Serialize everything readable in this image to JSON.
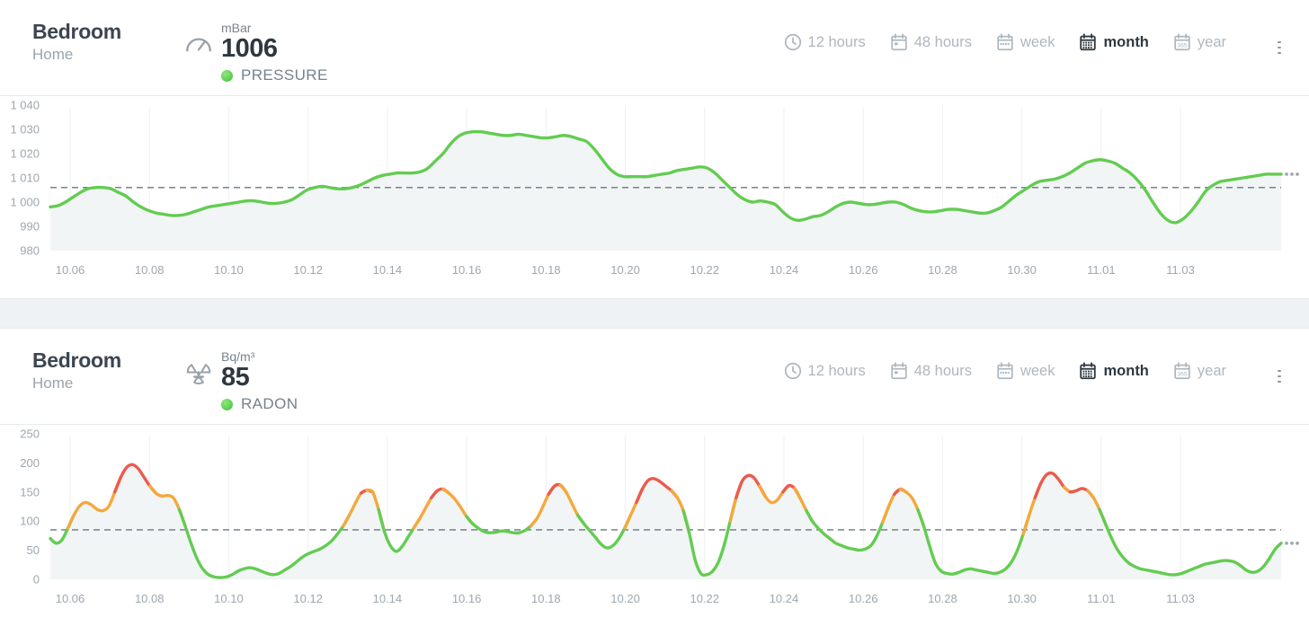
{
  "panels": [
    {
      "device": {
        "name": "Bedroom",
        "location": "Home"
      },
      "metric": {
        "icon": "gauge-icon",
        "unit": "mBar",
        "value": "1006",
        "label": "PRESSURE",
        "status_color": "#5ccd4d"
      },
      "ranges": [
        {
          "key": "12h",
          "label": "12 hours",
          "icon": "clock-icon",
          "active": false
        },
        {
          "key": "48h",
          "label": "48 hours",
          "icon": "calendar-2-icon",
          "active": false
        },
        {
          "key": "week",
          "label": "week",
          "icon": "calendar-7-icon",
          "active": false
        },
        {
          "key": "month",
          "label": "month",
          "icon": "calendar-30-icon",
          "active": true
        },
        {
          "key": "year",
          "label": "year",
          "icon": "calendar-365-icon",
          "active": false
        }
      ],
      "menu": {
        "label": "more-options"
      }
    },
    {
      "device": {
        "name": "Bedroom",
        "location": "Home"
      },
      "metric": {
        "icon": "radiation-icon",
        "unit": "Bq/m³",
        "value": "85",
        "label": "RADON",
        "status_color": "#5ccd4d"
      },
      "ranges": [
        {
          "key": "12h",
          "label": "12 hours",
          "icon": "clock-icon",
          "active": false
        },
        {
          "key": "48h",
          "label": "48 hours",
          "icon": "calendar-2-icon",
          "active": false
        },
        {
          "key": "week",
          "label": "week",
          "icon": "calendar-7-icon",
          "active": false
        },
        {
          "key": "month",
          "label": "month",
          "icon": "calendar-30-icon",
          "active": true
        },
        {
          "key": "year",
          "label": "year",
          "icon": "calendar-365-icon",
          "active": false
        }
      ],
      "menu": {
        "label": "more-options"
      }
    }
  ],
  "chart_data": [
    {
      "type": "area",
      "id": "pressure-chart",
      "title": "PRESSURE",
      "xlabel": "",
      "ylabel": "mBar",
      "ylim": [
        980,
        1040
      ],
      "yticks": [
        980,
        990,
        1000,
        1010,
        1020,
        1030,
        1040
      ],
      "ytick_labels": [
        "980",
        "990",
        "1 000",
        "1 010",
        "1 020",
        "1 030",
        "1 040"
      ],
      "xticks": [
        "10.06",
        "10.08",
        "10.10",
        "10.12",
        "10.14",
        "10.16",
        "10.18",
        "10.20",
        "10.22",
        "10.24",
        "10.26",
        "10.28",
        "10.30",
        "11.01",
        "11.03"
      ],
      "xlim": [
        "10.05",
        "11.04"
      ],
      "grid": "vertical",
      "reference_line": {
        "value": 1006,
        "style": "dashed",
        "color": "#6b7680"
      },
      "line_color": "#63cc52",
      "fill_color": "#f2f5f5",
      "trailing_dots": true,
      "x": [
        0,
        1,
        2,
        3,
        4,
        5,
        6,
        7,
        8,
        9,
        10,
        11,
        12,
        13,
        14,
        15,
        16,
        17,
        18,
        19,
        20,
        21,
        22,
        23,
        24,
        25,
        26,
        27,
        28,
        29,
        30,
        31,
        32,
        33,
        34,
        35,
        36,
        37,
        38,
        39,
        40,
        41,
        42,
        43,
        44,
        45,
        46,
        47,
        48,
        49,
        50,
        51,
        52,
        53,
        54,
        55,
        56,
        57,
        58,
        59,
        60,
        61,
        62,
        63,
        64,
        65,
        66,
        67,
        68,
        69,
        70,
        71,
        72,
        73,
        74,
        75,
        76,
        77,
        78,
        79,
        80,
        81,
        82,
        83,
        84,
        85,
        86,
        87,
        88,
        89,
        90,
        91,
        92,
        93,
        94,
        95,
        96,
        97,
        98,
        99,
        100,
        101,
        102,
        103,
        104,
        105,
        106,
        107,
        108,
        109,
        110,
        111,
        112,
        113,
        114,
        115,
        116,
        117,
        118,
        119
      ],
      "values": [
        998,
        998.5,
        1000,
        1002,
        1004,
        1005.5,
        1006,
        1006,
        1005.5,
        1004,
        1002.5,
        1000,
        998,
        996.5,
        995.5,
        995,
        994.5,
        994.5,
        995,
        996,
        997,
        998,
        998.5,
        999,
        999.5,
        1000,
        1000.5,
        1000.5,
        1000,
        999.5,
        999.5,
        1000,
        1001,
        1003,
        1005,
        1006,
        1006.5,
        1006,
        1005.5,
        1005.5,
        1006,
        1007,
        1008.5,
        1010,
        1011,
        1011.5,
        1012,
        1012,
        1012,
        1012.5,
        1014,
        1017,
        1020,
        1024,
        1027,
        1028.5,
        1029,
        1029,
        1028.5,
        1028,
        1027.5,
        1027.5,
        1028,
        1027.5,
        1027,
        1026.5,
        1026.5,
        1027,
        1027.5,
        1027,
        1026,
        1025,
        1022,
        1018,
        1014,
        1011.5,
        1010.5,
        1010.5,
        1010.5,
        1010.5,
        1011,
        1011.5,
        1012,
        1013,
        1013.5,
        1014,
        1014.5,
        1014,
        1012,
        1009,
        1006,
        1003,
        1001,
        1000,
        1000.5,
        1000,
        999,
        996,
        993.5,
        992.5,
        993,
        994,
        994.5,
        996,
        998,
        999.5,
        1000,
        999.5,
        999,
        999,
        999.5,
        1000,
        1000,
        999,
        997.5,
        996.5,
        996,
        996,
        996.5,
        997,
        997,
        996.5,
        996,
        995.5,
        995.5,
        996.5,
        998,
        1000.5,
        1003,
        1005,
        1007,
        1008.5,
        1009,
        1009.5,
        1010.5,
        1012,
        1014,
        1016,
        1017,
        1017.5,
        1017,
        1016,
        1014,
        1012,
        1009,
        1005,
        1000,
        995.5,
        992.5,
        991.5,
        993,
        996,
        1000,
        1004.5,
        1007,
        1008.5,
        1009,
        1009.5,
        1010,
        1010.5,
        1011,
        1011.5,
        1011.5,
        1011.5
      ]
    },
    {
      "type": "area",
      "id": "radon-chart",
      "title": "RADON",
      "xlabel": "",
      "ylabel": "Bq/m³",
      "ylim": [
        0,
        250
      ],
      "yticks": [
        0,
        50,
        100,
        150,
        200,
        250
      ],
      "ytick_labels": [
        "0",
        "50",
        "100",
        "150",
        "200",
        "250"
      ],
      "xticks": [
        "10.06",
        "10.08",
        "10.10",
        "10.12",
        "10.14",
        "10.16",
        "10.18",
        "10.20",
        "10.22",
        "10.24",
        "10.26",
        "10.28",
        "10.30",
        "11.01",
        "11.03"
      ],
      "xlim": [
        "10.05",
        "11.04"
      ],
      "grid": "vertical",
      "reference_line": {
        "value": 85,
        "style": "dashed",
        "color": "#6b7680"
      },
      "fill_color": "#f2f5f5",
      "trailing_dots": true,
      "color_thresholds": [
        {
          "max": 100,
          "color": "#63cc52",
          "name": "good"
        },
        {
          "max": 150,
          "color": "#f5a83c",
          "name": "fair"
        },
        {
          "max": 1000,
          "color": "#ec5a4e",
          "name": "high"
        }
      ],
      "values": [
        70,
        62,
        68,
        88,
        110,
        126,
        132,
        128,
        120,
        118,
        126,
        150,
        175,
        192,
        197,
        190,
        175,
        160,
        148,
        143,
        144,
        140,
        120,
        92,
        62,
        36,
        18,
        8,
        4,
        3,
        4,
        8,
        14,
        18,
        20,
        18,
        14,
        10,
        8,
        10,
        16,
        22,
        30,
        38,
        44,
        48,
        52,
        58,
        66,
        78,
        92,
        110,
        130,
        148,
        153,
        150,
        120,
        82,
        58,
        48,
        56,
        72,
        88,
        104,
        122,
        140,
        152,
        155,
        148,
        138,
        124,
        108,
        96,
        88,
        82,
        80,
        81,
        83,
        82,
        80,
        80,
        84,
        92,
        104,
        124,
        146,
        160,
        162,
        150,
        130,
        110,
        96,
        84,
        72,
        60,
        54,
        58,
        70,
        88,
        110,
        132,
        155,
        170,
        173,
        168,
        160,
        152,
        140,
        118,
        80,
        34,
        10,
        8,
        14,
        30,
        60,
        100,
        140,
        168,
        178,
        175,
        160,
        142,
        132,
        136,
        150,
        161,
        156,
        138,
        118,
        100,
        88,
        78,
        70,
        62,
        58,
        54,
        52,
        50,
        52,
        58,
        74,
        98,
        124,
        146,
        155,
        150,
        140,
        120,
        92,
        58,
        28,
        14,
        10,
        9,
        12,
        16,
        18,
        16,
        14,
        12,
        10,
        12,
        18,
        30,
        50,
        78,
        110,
        140,
        165,
        180,
        182,
        172,
        158,
        150,
        152,
        156,
        152,
        140,
        120,
        96,
        72,
        52,
        38,
        28,
        22,
        18,
        16,
        14,
        12,
        10,
        8,
        8,
        10,
        14,
        18,
        22,
        26,
        28,
        30,
        32,
        32,
        30,
        24,
        16,
        12,
        14,
        22,
        36,
        52,
        62
      ]
    }
  ]
}
